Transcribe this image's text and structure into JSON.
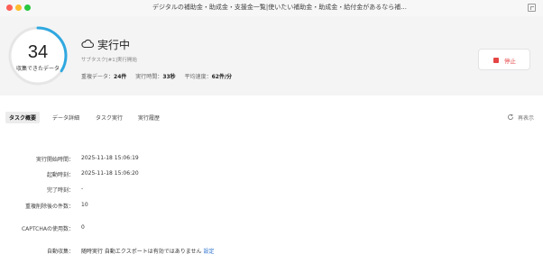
{
  "window": {
    "title": "デジタルの補助金・助成金・支援金一覧|使いたい補助金・助成金・給付金があるなら補..."
  },
  "progress": {
    "count": "34",
    "label": "収集できたデータ",
    "fraction": 0.34,
    "accent_color": "#2fa8e0"
  },
  "status": {
    "icon": "cloud-icon",
    "title": "実行中",
    "subtask": "サブタスク[#1]実行開始",
    "stats": {
      "duplicate_label": "重複データ：",
      "duplicate_value": "24件",
      "time_label": "実行時間：",
      "time_value": "33秒",
      "speed_label": "平均速度：",
      "speed_value": "62件/分"
    }
  },
  "stop_button": {
    "label": "停止",
    "color": "#e64545"
  },
  "tabs": [
    {
      "label": "タスク概要",
      "active": true
    },
    {
      "label": "データ詳細",
      "active": false
    },
    {
      "label": "タスク実行",
      "active": false
    },
    {
      "label": "実行履歴",
      "active": false
    }
  ],
  "refresh": {
    "label": "再表示",
    "icon": "refresh-icon"
  },
  "details": {
    "start_time": {
      "label": "実行開始時間：",
      "value": "2025-11-18 15:06:19"
    },
    "launch_time": {
      "label": "起動時刻：",
      "value": "2025-11-18 15:06:20"
    },
    "end_time": {
      "label": "完了時刻：",
      "value": "-"
    },
    "dedup_count": {
      "label": "重複削除後の件数：",
      "value": "10"
    },
    "captcha": {
      "label": "CAPTCHAの使用数：",
      "value": "0"
    },
    "auto_collect": {
      "label": "自動収集：",
      "value": "随時実行 自動エクスポートは有効ではありません",
      "link": "設定"
    }
  }
}
